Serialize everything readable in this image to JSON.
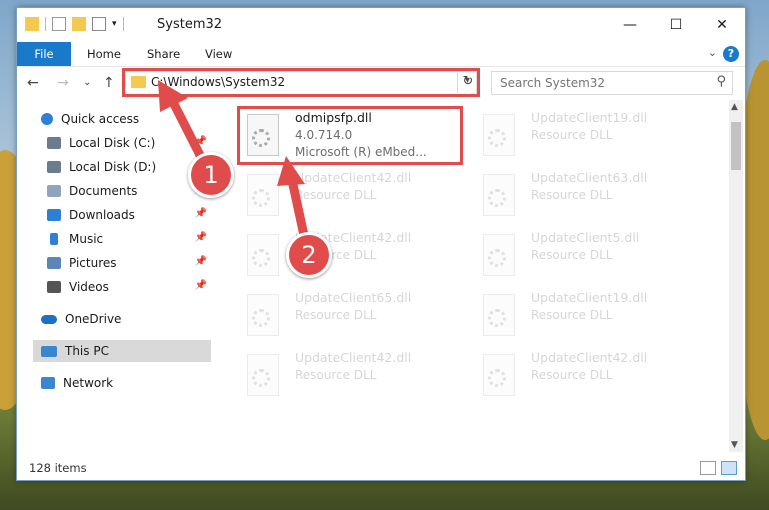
{
  "window": {
    "title": "System32",
    "minimize": "—",
    "maximize": "☐",
    "close": "✕"
  },
  "ribbon": {
    "tabs": [
      "File",
      "Home",
      "Share",
      "View"
    ],
    "help": "?",
    "expand": "⌄"
  },
  "nav": {
    "back": "←",
    "forward": "→",
    "recent": "⌄",
    "up": "↑",
    "address": "C:\\Windows\\System32",
    "refresh": "↻",
    "search_placeholder": "Search System32"
  },
  "sidebar": {
    "items": [
      {
        "label": "Quick access",
        "icon": "star-icon",
        "color": "#2e7fd6"
      },
      {
        "label": "Local Disk (C:)",
        "icon": "drive-icon",
        "color": "#6b7c8f"
      },
      {
        "label": "Local Disk (D:)",
        "icon": "drive-icon",
        "color": "#6b7c8f"
      },
      {
        "label": "Documents",
        "icon": "documents-icon",
        "color": "#8fa4bf"
      },
      {
        "label": "Downloads",
        "icon": "downloads-icon",
        "color": "#2e7fd6"
      },
      {
        "label": "Music",
        "icon": "music-icon",
        "color": "#2e7fd6"
      },
      {
        "label": "Pictures",
        "icon": "pictures-icon",
        "color": "#5b86b8"
      },
      {
        "label": "Videos",
        "icon": "videos-icon",
        "color": "#555555"
      },
      {
        "label": "OneDrive",
        "icon": "cloud-icon",
        "color": "#1e6fc7"
      },
      {
        "label": "This PC",
        "icon": "computer-icon",
        "color": "#3a86d0"
      },
      {
        "label": "Network",
        "icon": "network-icon",
        "color": "#3a86d0"
      }
    ]
  },
  "files": {
    "highlighted": {
      "name": "odmipsfp.dll",
      "version": "4.0.714.0",
      "description": "Microsoft (R) eMbed..."
    },
    "faded": [
      {
        "name": "UpdateClient19.dll",
        "type": "Resource DLL"
      },
      {
        "name": "UpdateClient42.dll",
        "type": "Resource DLL"
      },
      {
        "name": "UpdateClient63.dll",
        "type": "Resource DLL"
      },
      {
        "name": "UpdateClient42.dll",
        "type": "Resource DLL"
      },
      {
        "name": "UpdateClient5.dll",
        "type": "Resource DLL"
      },
      {
        "name": "UpdateClient65.dll",
        "type": "Resource DLL"
      },
      {
        "name": "UpdateClient19.dll",
        "type": "Resource DLL"
      },
      {
        "name": "UpdateClient42.dll",
        "type": "Resource DLL"
      },
      {
        "name": "UpdateClient42.dll",
        "type": "Resource DLL"
      }
    ]
  },
  "status": {
    "item_count": "128 items"
  },
  "annotations": {
    "step1": "1",
    "step2": "2",
    "color": "#e04b4b"
  }
}
